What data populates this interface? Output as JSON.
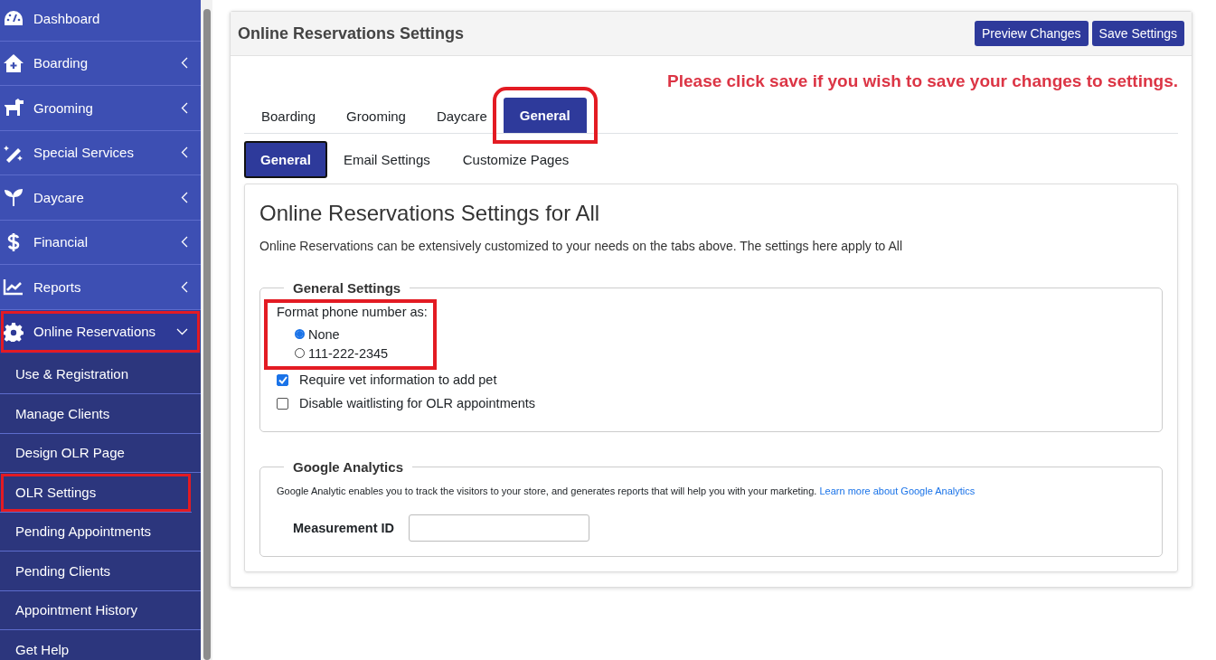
{
  "sidebar": {
    "items": [
      {
        "label": "Dashboard",
        "kind": "link",
        "selected": false,
        "highlighted": false
      },
      {
        "label": "Boarding",
        "kind": "menu",
        "expanded": false,
        "selected": false,
        "highlighted": false
      },
      {
        "label": "Grooming",
        "kind": "menu",
        "expanded": false,
        "selected": false,
        "highlighted": false
      },
      {
        "label": "Special Services",
        "kind": "menu",
        "expanded": false,
        "selected": false,
        "highlighted": false
      },
      {
        "label": "Daycare",
        "kind": "menu",
        "expanded": false,
        "selected": false,
        "highlighted": false
      },
      {
        "label": "Financial",
        "kind": "menu",
        "expanded": false,
        "selected": false,
        "highlighted": false
      },
      {
        "label": "Reports",
        "kind": "menu",
        "expanded": false,
        "selected": false,
        "highlighted": false
      },
      {
        "label": "Online Reservations",
        "kind": "menu",
        "expanded": true,
        "selected": true,
        "highlighted": true,
        "children": [
          {
            "label": "Use & Registration",
            "highlighted": false
          },
          {
            "label": "Manage Clients",
            "highlighted": false
          },
          {
            "label": "Design OLR Page",
            "highlighted": false
          },
          {
            "label": "OLR Settings",
            "highlighted": true
          },
          {
            "label": "Pending Appointments",
            "highlighted": false
          },
          {
            "label": "Pending Clients",
            "highlighted": false
          },
          {
            "label": "Appointment History",
            "highlighted": false
          },
          {
            "label": "Get Help",
            "highlighted": false
          }
        ]
      }
    ]
  },
  "panel": {
    "title": "Online Reservations Settings",
    "buttons": [
      "Preview Changes",
      "Save Settings"
    ],
    "notice": "Please click save if you wish to save your changes to settings.",
    "tabs": [
      {
        "label": "Boarding",
        "selected": false,
        "highlighted": false
      },
      {
        "label": "Grooming",
        "selected": false,
        "highlighted": false
      },
      {
        "label": "Daycare",
        "selected": false,
        "highlighted": false
      },
      {
        "label": "General",
        "selected": true,
        "highlighted": true
      }
    ],
    "subtabs": [
      {
        "label": "General",
        "selected": true
      },
      {
        "label": "Email Settings",
        "selected": false
      },
      {
        "label": "Customize Pages",
        "selected": false
      }
    ],
    "card": {
      "heading": "Online Reservations Settings for All",
      "description": "Online Reservations can be extensively customized to your needs on the tabs above. The settings here apply to All",
      "general_settings": {
        "legend": "General Settings",
        "phone_format": {
          "label": "Format phone number as:",
          "highlighted": true,
          "options": [
            {
              "label": "None",
              "selected": true
            },
            {
              "label": "111-222-2345",
              "selected": false
            }
          ]
        },
        "checkboxes": [
          {
            "label": "Require vet information to add pet",
            "checked": true
          },
          {
            "label": "Disable waitlisting for OLR appointments",
            "checked": false
          }
        ]
      },
      "google_analytics": {
        "legend": "Google Analytics",
        "description": "Google Analytic enables you to track the visitors to your store, and generates reports that will help you with your marketing.",
        "link": "Learn more about Google Analytics",
        "measurement_label": "Measurement ID"
      }
    }
  }
}
